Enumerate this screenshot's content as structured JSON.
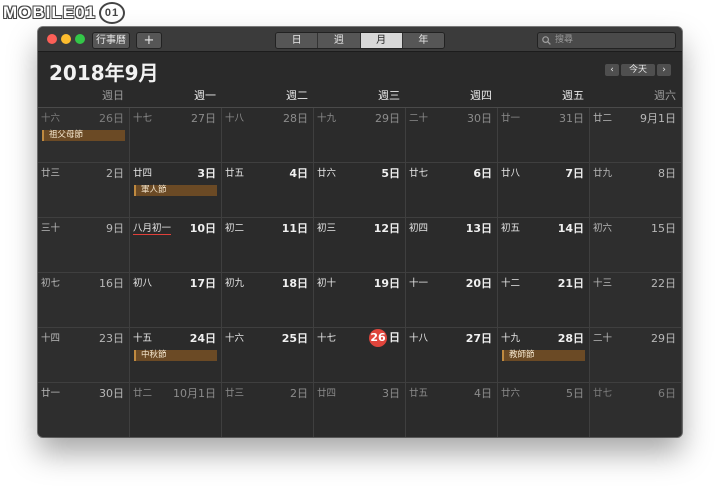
{
  "watermark": "MOBILE01",
  "watermark_badge": "01",
  "toolbar": {
    "calendars_label": "行事曆",
    "add_label": "+",
    "views": [
      "日",
      "週",
      "月",
      "年"
    ],
    "active_view": "月",
    "search_placeholder": "搜尋"
  },
  "header": {
    "month_title": "2018年9月",
    "prev": "‹",
    "today": "今天",
    "next": "›"
  },
  "weekdays": [
    "週日",
    "週一",
    "週二",
    "週三",
    "週四",
    "週五",
    "週六"
  ],
  "weeks": [
    [
      {
        "lunar": "十六",
        "solar": "26日",
        "dim": true,
        "event": "祖父母節"
      },
      {
        "lunar": "十七",
        "solar": "27日",
        "dim": true
      },
      {
        "lunar": "十八",
        "solar": "28日",
        "dim": true
      },
      {
        "lunar": "十九",
        "solar": "29日",
        "dim": true
      },
      {
        "lunar": "二十",
        "solar": "30日",
        "dim": true
      },
      {
        "lunar": "廿一",
        "solar": "31日",
        "dim": true
      },
      {
        "lunar": "廿二",
        "solar": "9月1日"
      }
    ],
    [
      {
        "lunar": "廿三",
        "solar": "2日"
      },
      {
        "lunar": "廿四",
        "solar": "3日",
        "event": "軍人節"
      },
      {
        "lunar": "廿五",
        "solar": "4日"
      },
      {
        "lunar": "廿六",
        "solar": "5日"
      },
      {
        "lunar": "廿七",
        "solar": "6日"
      },
      {
        "lunar": "廿八",
        "solar": "7日"
      },
      {
        "lunar": "廿九",
        "solar": "8日"
      }
    ],
    [
      {
        "lunar": "三十",
        "solar": "9日"
      },
      {
        "lunar": "八月初一",
        "solar": "10日",
        "underline": true
      },
      {
        "lunar": "初二",
        "solar": "11日"
      },
      {
        "lunar": "初三",
        "solar": "12日"
      },
      {
        "lunar": "初四",
        "solar": "13日"
      },
      {
        "lunar": "初五",
        "solar": "14日"
      },
      {
        "lunar": "初六",
        "solar": "15日"
      }
    ],
    [
      {
        "lunar": "初七",
        "solar": "16日"
      },
      {
        "lunar": "初八",
        "solar": "17日"
      },
      {
        "lunar": "初九",
        "solar": "18日"
      },
      {
        "lunar": "初十",
        "solar": "19日"
      },
      {
        "lunar": "十一",
        "solar": "20日"
      },
      {
        "lunar": "十二",
        "solar": "21日"
      },
      {
        "lunar": "十三",
        "solar": "22日"
      }
    ],
    [
      {
        "lunar": "十四",
        "solar": "23日"
      },
      {
        "lunar": "十五",
        "solar": "24日",
        "event": "中秋節"
      },
      {
        "lunar": "十六",
        "solar": "25日"
      },
      {
        "lunar": "十七",
        "solar": "26日",
        "today": true
      },
      {
        "lunar": "十八",
        "solar": "27日"
      },
      {
        "lunar": "十九",
        "solar": "28日",
        "event": "教師節"
      },
      {
        "lunar": "二十",
        "solar": "29日"
      }
    ],
    [
      {
        "lunar": "廿一",
        "solar": "30日"
      },
      {
        "lunar": "廿二",
        "solar": "10月1日",
        "dim": true
      },
      {
        "lunar": "廿三",
        "solar": "2日",
        "dim": true
      },
      {
        "lunar": "廿四",
        "solar": "3日",
        "dim": true
      },
      {
        "lunar": "廿五",
        "solar": "4日",
        "dim": true
      },
      {
        "lunar": "廿六",
        "solar": "5日",
        "dim": true
      },
      {
        "lunar": "廿七",
        "solar": "6日",
        "dim": true
      }
    ]
  ],
  "colors": {
    "window_bg": "#2a2a2a",
    "event_bg": "#6b4a25",
    "today_circle": "#e0453c",
    "traffic_close": "#fc5f57",
    "traffic_min": "#fdbc2e",
    "traffic_max": "#33c748"
  }
}
